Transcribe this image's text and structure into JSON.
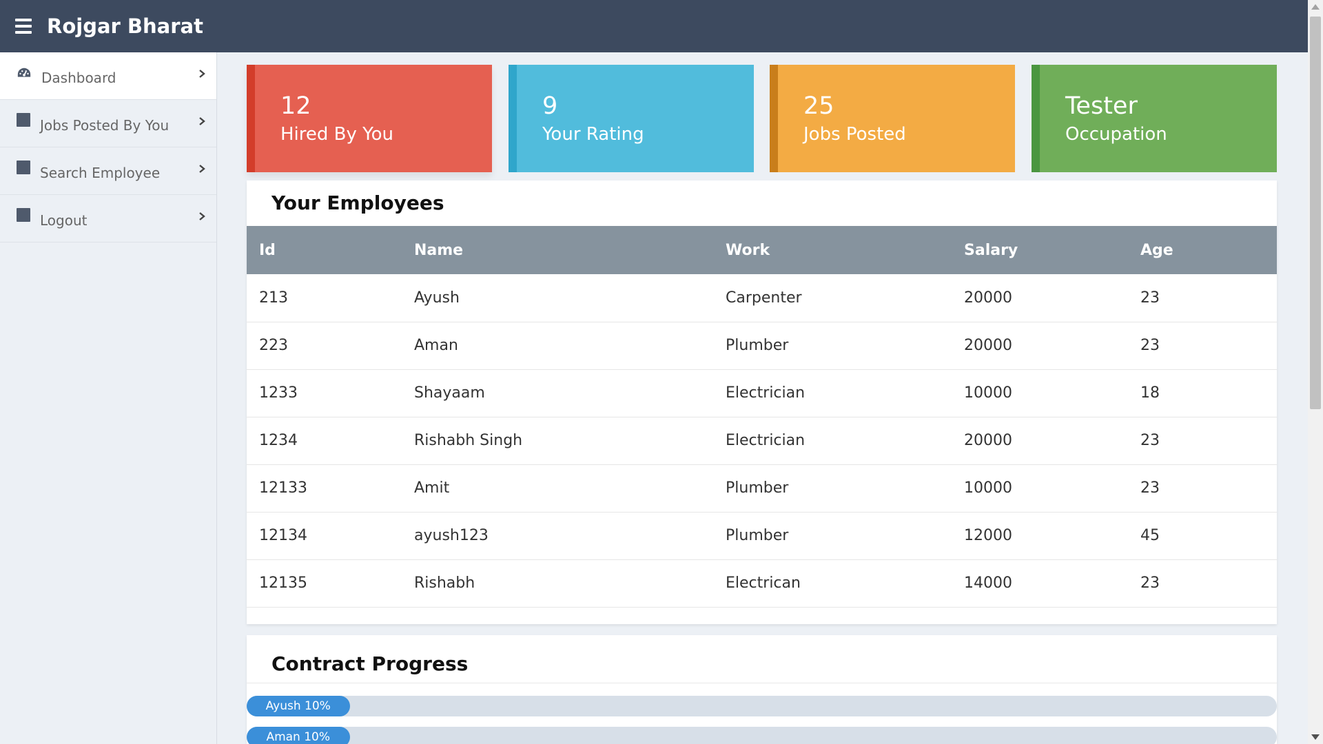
{
  "app": {
    "title": "Rojgar Bharat"
  },
  "sidebar": {
    "items": [
      {
        "label": "Dashboard",
        "icon": "dashboard-gauge-icon"
      },
      {
        "label": "Jobs Posted By You",
        "icon": "square-icon"
      },
      {
        "label": "Search Employee",
        "icon": "square-icon"
      },
      {
        "label": "Logout",
        "icon": "square-icon"
      }
    ]
  },
  "stats": [
    {
      "value": "12",
      "label": "Hired By You",
      "color": "#e56051"
    },
    {
      "value": "9",
      "label": "Your Rating",
      "color": "#51bcdc"
    },
    {
      "value": "25",
      "label": "Jobs Posted",
      "color": "#f3ab44"
    },
    {
      "value": "Tester",
      "label": "Occupation",
      "color": "#70ae59"
    }
  ],
  "employees": {
    "title": "Your Employees",
    "columns": [
      "Id",
      "Name",
      "Work",
      "Salary",
      "Age"
    ],
    "rows": [
      [
        "213",
        "Ayush",
        "Carpenter",
        "20000",
        "23"
      ],
      [
        "223",
        "Aman",
        "Plumber",
        "20000",
        "23"
      ],
      [
        "1233",
        "Shayaam",
        "Electrician",
        "10000",
        "18"
      ],
      [
        "1234",
        "Rishabh Singh",
        "Electrician",
        "20000",
        "23"
      ],
      [
        "12133",
        "Amit",
        "Plumber",
        "10000",
        "23"
      ],
      [
        "12134",
        "ayush123",
        "Plumber",
        "12000",
        "45"
      ],
      [
        "12135",
        "Rishabh",
        "Electrican",
        "14000",
        "23"
      ]
    ]
  },
  "progress": {
    "title": "Contract Progress",
    "items": [
      {
        "label": "Ayush 10%",
        "percent": 10
      },
      {
        "label": "Aman 10%",
        "percent": 10
      }
    ]
  }
}
